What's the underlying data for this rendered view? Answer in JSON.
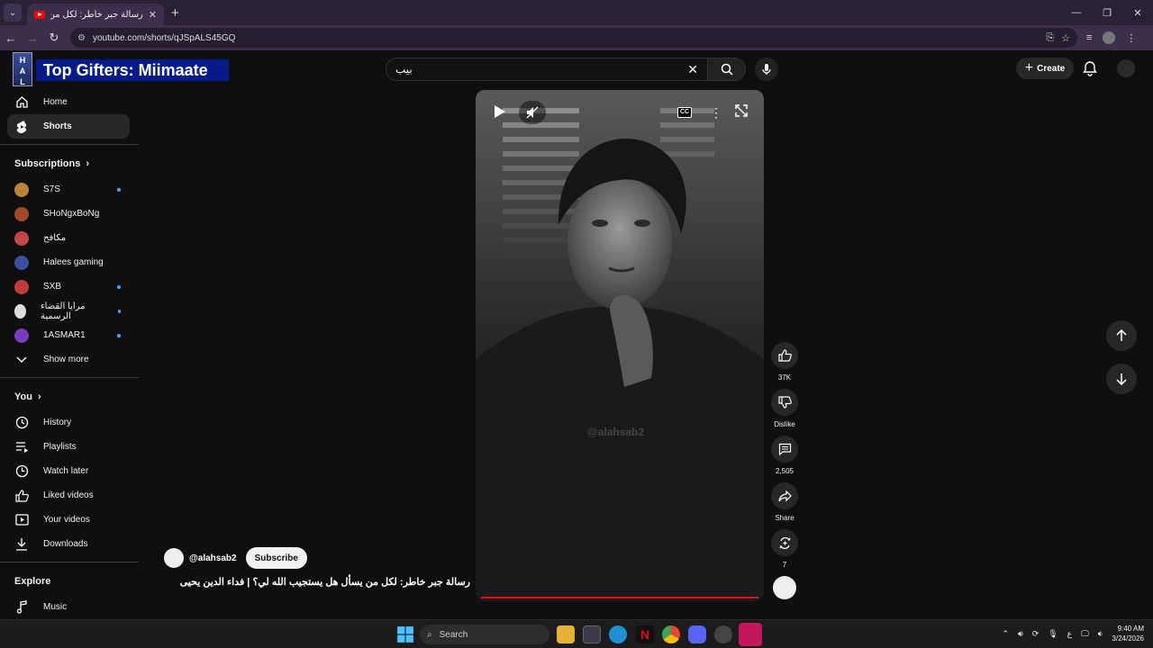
{
  "browser": {
    "tab_title": "رسالة جبر خاطر: لكل من يسأل هل",
    "url": "youtube.com/shorts/qJSpALS45GQ",
    "accent": "#2b2137"
  },
  "header": {
    "overlay_text": "Top Gifters: Miimaate",
    "search_value": "بيب",
    "create_label": "Create"
  },
  "sidebar": {
    "nav": [
      {
        "label": "Home",
        "icon": "home-icon"
      },
      {
        "label": "Shorts",
        "icon": "shorts-icon"
      }
    ],
    "subscriptions_title": "Subscriptions",
    "subscriptions": [
      {
        "label": "S7S",
        "color": "#b9833a",
        "new": true
      },
      {
        "label": "SHoNgxBoNg",
        "color": "#a04a2a",
        "new": false
      },
      {
        "label": "مكافح",
        "color": "#c64545",
        "new": false
      },
      {
        "label": "Halees gaming",
        "color": "#3b4f9e",
        "new": false
      },
      {
        "label": "SXB",
        "color": "#c23a3a",
        "new": true
      },
      {
        "label": "مرايا القضاء الرسمية",
        "color": "#dddddd",
        "new": true
      },
      {
        "label": "1ASMAR1",
        "color": "#7a3bc0",
        "new": true
      }
    ],
    "show_more": "Show more",
    "you_title": "You",
    "you_items": [
      {
        "label": "History",
        "icon": "history-icon"
      },
      {
        "label": "Playlists",
        "icon": "playlists-icon"
      },
      {
        "label": "Watch later",
        "icon": "watch-later-icon"
      },
      {
        "label": "Liked videos",
        "icon": "liked-icon"
      },
      {
        "label": "Your videos",
        "icon": "your-videos-icon"
      },
      {
        "label": "Downloads",
        "icon": "download-icon"
      }
    ],
    "explore_title": "Explore",
    "explore_items": [
      {
        "label": "Music",
        "icon": "music-icon"
      }
    ]
  },
  "short": {
    "watermark": "@alahsab2",
    "channel": "@alahsab2",
    "subscribe_label": "Subscribe",
    "title": "رسالة جبر خاطر: لكل من يسأل هل يستجيب الله لي؟ | فداء الدين يحيى",
    "progress": 0.99,
    "likes": "37K",
    "dislike_label": "Dislike",
    "comments": "2,505",
    "share_label": "Share",
    "remix_count": "7"
  },
  "taskbar": {
    "search_label": "Search",
    "lang": "ع",
    "time": "9:40 AM",
    "date": "3/24/2026"
  }
}
